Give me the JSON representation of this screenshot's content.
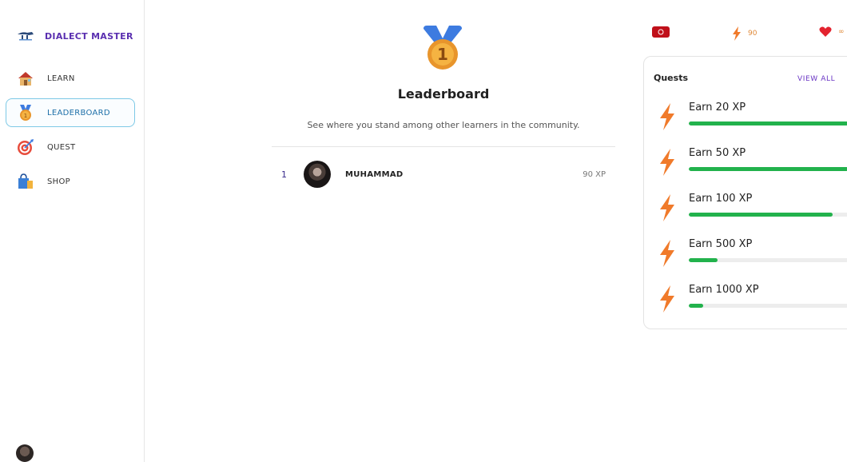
{
  "app": {
    "title": "DIALECT MASTER"
  },
  "sidebar": {
    "items": [
      {
        "label": "LEARN",
        "icon": "house-icon",
        "active": false
      },
      {
        "label": "LEADERBOARD",
        "icon": "medal-icon",
        "active": true
      },
      {
        "label": "QUEST",
        "icon": "target-icon",
        "active": false
      },
      {
        "label": "SHOP",
        "icon": "shopping-bag-icon",
        "active": false
      }
    ]
  },
  "stats": {
    "xp": "90",
    "hearts": "∞",
    "flag_icon": "flag-icon"
  },
  "leaderboard": {
    "title": "Leaderboard",
    "subtitle": "See where you stand among other learners in the community.",
    "rows": [
      {
        "rank": "1",
        "name": "MUHAMMAD",
        "xp": "90 XP"
      }
    ]
  },
  "quests": {
    "title": "Quests",
    "view_all": "VIEW ALL",
    "items": [
      {
        "label": "Earn 20 XP",
        "progress": 1.0
      },
      {
        "label": "Earn 50 XP",
        "progress": 1.0
      },
      {
        "label": "Earn 100 XP",
        "progress": 0.9
      },
      {
        "label": "Earn 500 XP",
        "progress": 0.18
      },
      {
        "label": "Earn 1000 XP",
        "progress": 0.09
      }
    ]
  },
  "colors": {
    "brand": "#5a2fb0",
    "active_border": "#7ec9e6",
    "progress": "#22b24c",
    "xp": "#e08a3a"
  }
}
